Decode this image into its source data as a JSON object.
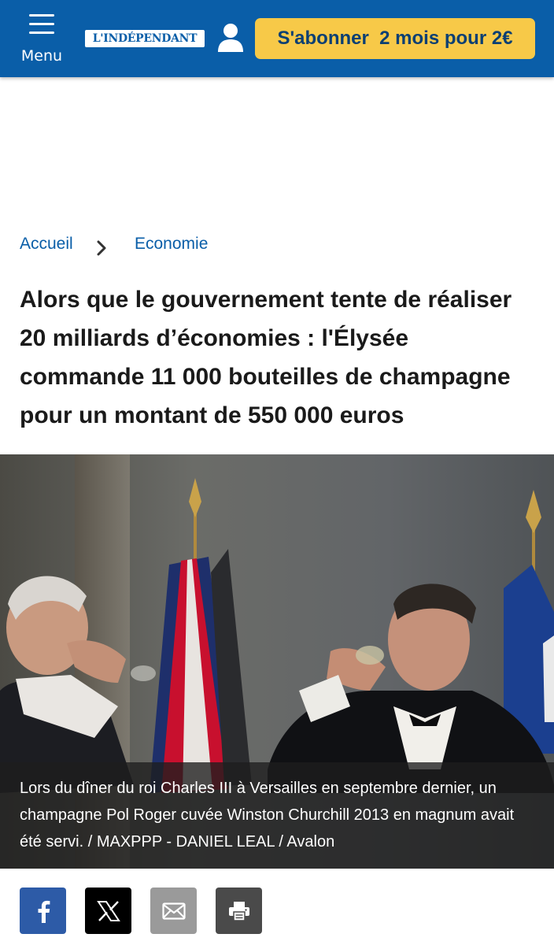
{
  "header": {
    "menu_label": "Menu",
    "logo_text": "L'INDÉPENDANT",
    "subscribe_label": "S'abonner  2 mois pour 2€",
    "bg_color": "#0a5ea8",
    "subscribe_color": "#f7c948"
  },
  "breadcrumb": {
    "home": "Accueil",
    "category": "Economie"
  },
  "article": {
    "headline": "Alors que le gouvernement tente de réaliser 20 milliards d’économies : l'Élysée commande 11 000 bouteilles de champagne pour un montant de 550 000 euros",
    "photo_caption": "Lors du dîner du roi Charles III à Versailles en septembre dernier, un champagne Pol Roger cuvée Winston Churchill 2013 en magnum avait été servi.  / MAXPPP - DANIEL LEAL / Avalon"
  },
  "share": {
    "icons": [
      "facebook-icon",
      "x-icon",
      "mail-icon",
      "print-icon"
    ]
  }
}
